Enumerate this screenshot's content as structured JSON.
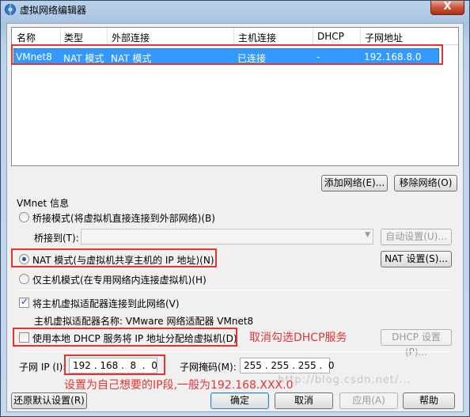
{
  "window": {
    "title": "虚拟网络编辑器",
    "close_label": "X"
  },
  "table": {
    "headers": [
      "名称",
      "类型",
      "外部连接",
      "主机连接",
      "DHCP",
      "子网地址"
    ],
    "rows": [
      {
        "name": "VMnet8",
        "type": "NAT 模式",
        "external": "NAT 模式",
        "host": "已连接",
        "dhcp": "-",
        "subnet": "192.168.8.0"
      }
    ]
  },
  "list_buttons": {
    "add": "添加网络(E)...",
    "remove": "移除网络(O)"
  },
  "vmnet_info": {
    "group_label": "VMnet 信息",
    "bridged": "桥接模式(将虚拟机直接连接到外部网络)(B)",
    "bridge_to_label": "桥接到(T):",
    "auto_settings": "自动设置(U)...",
    "nat": "NAT 模式(与虚拟机共享主机的 IP 地址)(N)",
    "nat_settings": "NAT 设置(S)...",
    "host_only": "仅主机模式(在专用网络内连接虚拟机)(H)",
    "connect_adapter": "将主机虚拟适配器连接到此网络(V)",
    "adapter_name": "主机虚拟适配器名称: VMware 网络适配器 VMnet8",
    "use_dhcp": "使用本地 DHCP 服务将 IP 地址分配给虚拟机(D)",
    "dhcp_settings": "DHCP 设置(P)...",
    "subnet_ip_label": "子网 IP (I):",
    "subnet_ip": "192 . 168 .  8  .  0",
    "subnet_mask_label": "子网掩码(M):",
    "subnet_mask": "255 . 255 . 255 .  0"
  },
  "footer": {
    "restore": "还原默认设置(R)",
    "ok": "确定",
    "cancel": "取消",
    "apply": "应用(A)",
    "help": "帮助"
  },
  "annotations": {
    "uncheck_dhcp": "取消勾选DHCP服务",
    "set_ip": "设置为自己想要的IP段,一般为192.168.XXX.0"
  },
  "watermark": "http://blog.csdn.net/...",
  "colors": {
    "selection": "#3399ff",
    "annotation": "#e53333"
  }
}
